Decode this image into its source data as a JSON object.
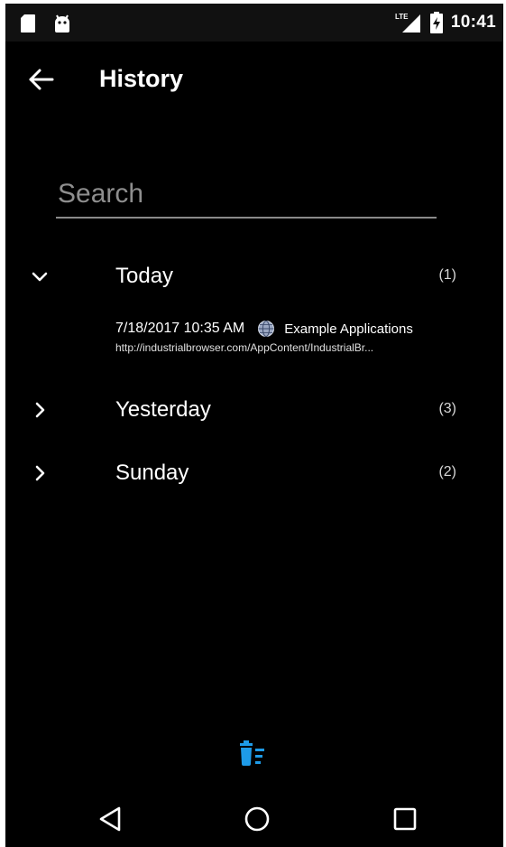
{
  "status_bar": {
    "time": "10:41",
    "network": "LTE",
    "icons": [
      "sd-card-icon",
      "android-icon",
      "lte-signal-icon",
      "battery-charging-icon"
    ]
  },
  "header": {
    "title": "History",
    "back_icon": "arrow-back-icon"
  },
  "search": {
    "placeholder": "Search",
    "value": ""
  },
  "groups": [
    {
      "label": "Today",
      "count": "(1)",
      "expanded": true,
      "entries": [
        {
          "date": "7/18/2017 10:35 AM",
          "icon": "globe-icon",
          "title": "Example Applications",
          "url": "http://industrialbrowser.com/AppContent/IndustrialBr..."
        }
      ]
    },
    {
      "label": "Yesterday",
      "count": "(3)",
      "expanded": false
    },
    {
      "label": "Sunday",
      "count": "(2)",
      "expanded": false
    }
  ],
  "actions": {
    "clear_icon": "delete-sweep-icon"
  },
  "nav": {
    "back_icon": "nav-back-icon",
    "home_icon": "nav-home-icon",
    "recents_icon": "nav-recents-icon"
  },
  "colors": {
    "background": "#000000",
    "accent": "#1e9be8",
    "text": "#ffffff",
    "divider": "#8a8a8a"
  }
}
